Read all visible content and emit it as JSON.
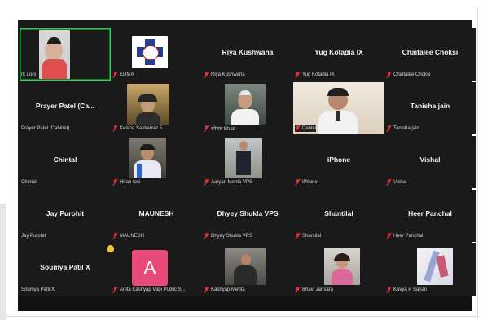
{
  "meeting": {
    "tiles": [
      {
        "display_name": "",
        "label": "rk uoni",
        "video": "webcam",
        "active": true
      },
      {
        "display_name": "",
        "label": "EDMA",
        "video": "logo"
      },
      {
        "display_name": "Riya Kushwaha",
        "label": "Riya Kushwaha"
      },
      {
        "display_name": "Yug Kotadia IX",
        "label": "Yug Kotadia IX"
      },
      {
        "display_name": "Chaitalee Choksi",
        "label": "Chaitalee Choksi"
      },
      {
        "display_name": "Prayer Patel (Ca...",
        "label": "Prayer Patel (Cabinet)"
      },
      {
        "display_name": "",
        "label": "Keisha Saxkamar 5",
        "video": "webcam"
      },
      {
        "display_name": "",
        "label": "कोशल Bhatt",
        "video": "webcam"
      },
      {
        "display_name": "",
        "label": "Daniel",
        "video": "webcam"
      },
      {
        "display_name": "Tanisha jain",
        "label": "Tanisha jain"
      },
      {
        "display_name": "Chintal",
        "label": "Chintal"
      },
      {
        "display_name": "",
        "label": "Hiran Iosi",
        "video": "webcam"
      },
      {
        "display_name": "",
        "label": "Aaryan Mehta VPS",
        "video": "webcam"
      },
      {
        "display_name": "iPhone",
        "label": "iPhone"
      },
      {
        "display_name": "Vishal",
        "label": "Vishal"
      },
      {
        "display_name": "Jay Purohit",
        "label": "Jay Purohit"
      },
      {
        "display_name": "MAUNESH",
        "label": "MAUNESH"
      },
      {
        "display_name": "Dhyey Shukla VPS",
        "label": "Dhyey Shukla VPS"
      },
      {
        "display_name": "Shantilal",
        "label": "Shantilal"
      },
      {
        "display_name": "Heer Panchal",
        "label": "Heer Panchal"
      },
      {
        "display_name": "Soumya Patil X",
        "label": "Soumya Patil X"
      },
      {
        "display_name": "",
        "label": "Anita Kashyap Vapi Public S...",
        "video": "avatar",
        "avatar_letter": "A"
      },
      {
        "display_name": "",
        "label": "Kashyap Mehta",
        "video": "webcam"
      },
      {
        "display_name": "",
        "label": "Bhavi Jansara",
        "video": "webcam"
      },
      {
        "display_name": "",
        "label": "Kavya P Sanan",
        "video": "webcam"
      }
    ]
  },
  "colors": {
    "gallery_bg": "#1a1a1a",
    "active_border": "#23d94a",
    "mute": "#e43030",
    "avatar_bg": "#e84a7a"
  }
}
